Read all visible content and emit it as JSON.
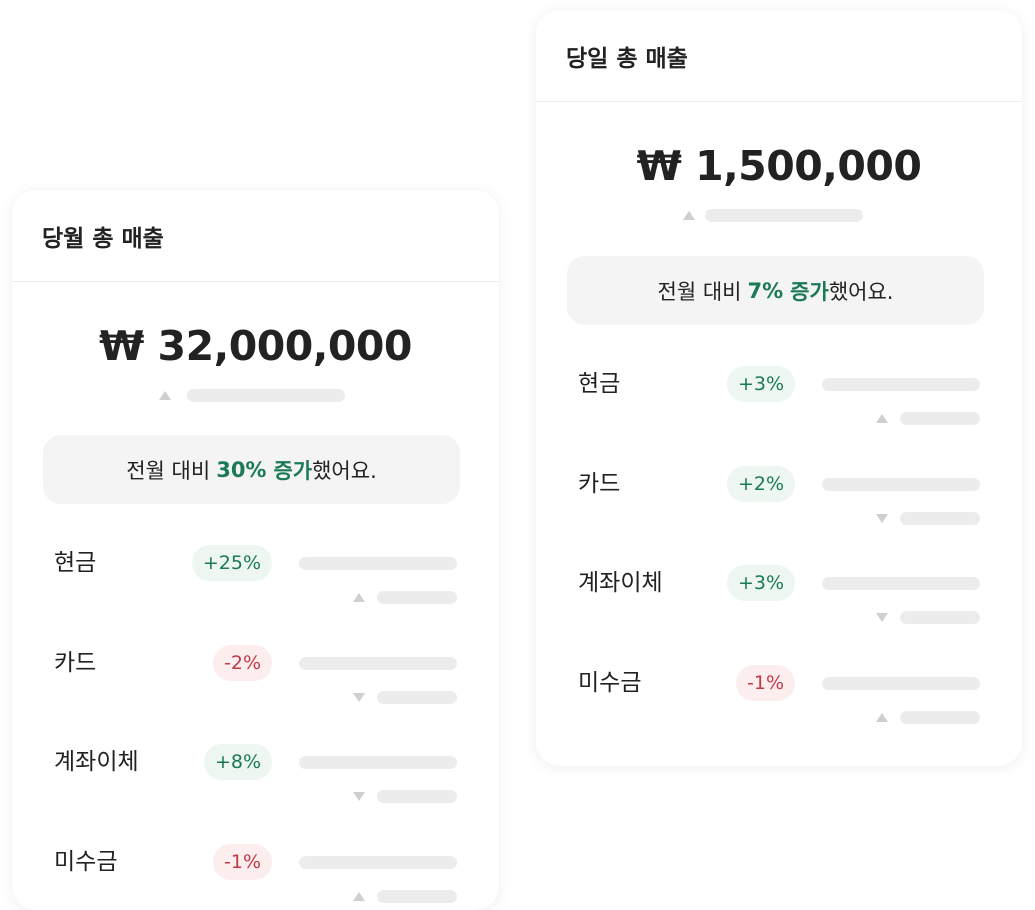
{
  "colors": {
    "increase": "#1b7a55",
    "increase_bg": "#edf6f1",
    "decrease": "#c23a46",
    "decrease_bg": "#fcedee",
    "panel_bg": "#f4f4f4",
    "skeleton": "#ececec"
  },
  "monthly": {
    "title": "당월 총 매출",
    "total": "₩ 32,000,000",
    "compare": {
      "prefix": "전월 대비",
      "pct": "30%",
      "word": "증가",
      "suffix": "했어요."
    },
    "rows": [
      {
        "label": "현금",
        "change": "+25%",
        "trend": "up"
      },
      {
        "label": "카드",
        "change": "-2%",
        "trend": "down"
      },
      {
        "label": "계좌이체",
        "change": "+8%",
        "trend": "down"
      },
      {
        "label": "미수금",
        "change": "-1%",
        "trend": "up"
      }
    ]
  },
  "daily": {
    "title": "당일 총 매출",
    "total": "₩ 1,500,000",
    "compare": {
      "prefix": "전월 대비",
      "pct": "7%",
      "word": "증가",
      "suffix": "했어요."
    },
    "rows": [
      {
        "label": "현금",
        "change": "+3%",
        "trend": "up"
      },
      {
        "label": "카드",
        "change": "+2%",
        "trend": "down"
      },
      {
        "label": "계좌이체",
        "change": "+3%",
        "trend": "down"
      },
      {
        "label": "미수금",
        "change": "-1%",
        "trend": "up"
      }
    ]
  }
}
